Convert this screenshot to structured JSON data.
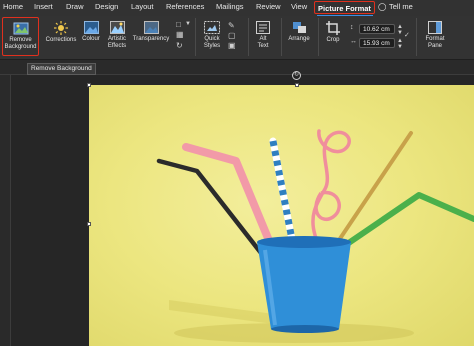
{
  "tabs": [
    "Home",
    "Insert",
    "Draw",
    "Design",
    "Layout",
    "References",
    "Mailings",
    "Review",
    "View",
    "Picture Format",
    "Tell me"
  ],
  "ribbon": {
    "remove_background": [
      "Remove",
      "Background"
    ],
    "corrections": "Corrections",
    "colour": "Colour",
    "artistic_effects": [
      "Artistic",
      "Effects"
    ],
    "transparency": "Transparency",
    "quick_styles": [
      "Quick",
      "Styles"
    ],
    "alt_text": [
      "Alt",
      "Text"
    ],
    "arrange": "Arrange",
    "crop": "Crop",
    "height": "10.62 cm",
    "width": "15.93 cm",
    "format_pane": [
      "Format",
      "Pane"
    ]
  },
  "tooltip": "Remove Background",
  "colors": {
    "active_tab_outline": "#e0301e",
    "ribbon_bg": "#333333",
    "photo_bg": "#ece680"
  }
}
